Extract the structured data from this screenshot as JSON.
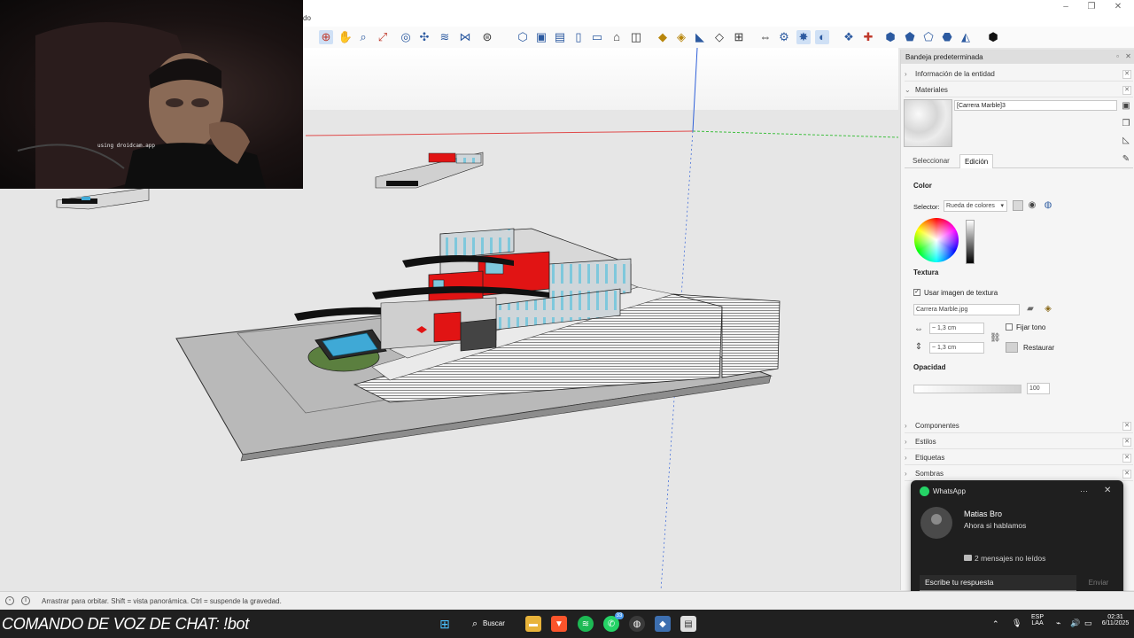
{
  "titlebar": {
    "menu_fragment": "do"
  },
  "toolbar": {
    "icons": [
      "orbit-icon",
      "pan-icon",
      "zoom-icon",
      "zoom-extents-icon",
      "component-icon",
      "solid-tools-icon",
      "layers-icon",
      "sandbox-icon",
      "warehouse-icon",
      "view-iso-icon",
      "view-top-icon",
      "view-front-icon",
      "view-right-icon",
      "view-back-icon",
      "view-left-icon",
      "section-plane-icon",
      "paint-bucket-icon",
      "tape-measure-icon",
      "protractor-icon",
      "walk-icon",
      "look-around-icon",
      "position-camera-icon",
      "extension-icon",
      "extension-warehouse-icon",
      "ruby-icon",
      "dynamic-component-icon",
      "sketchup-logo-icon"
    ]
  },
  "webcam": {
    "overlay_text": "using droidcam.app"
  },
  "panel": {
    "title": "Bandeja predeterminada",
    "entity_info": "Información de la entidad",
    "materials": "Materiales",
    "material_name": "[Carrera Marble]3",
    "tabs": [
      "Seleccionar",
      "Edición"
    ],
    "active_tab": "Edición",
    "color_label": "Color",
    "selector_label": "Selector:",
    "selector_value": "Rueda de colores",
    "texture_label": "Textura",
    "use_texture_label": "Usar imagen de textura",
    "use_texture_checked": true,
    "texture_file": "Carrera Marble.jpg",
    "width_value": "~ 1,3 cm",
    "height_value": "~ 1,3 cm",
    "colorize_label": "Fijar tono",
    "restore_label": "Restaurar",
    "opacity_label": "Opacidad",
    "opacity_value": "100",
    "collapsed_sections": [
      "Componentes",
      "Estilos",
      "Etiquetas",
      "Sombras"
    ]
  },
  "toast": {
    "app": "WhatsApp",
    "sender": "Matias Bro",
    "message": "Ahora si hablamos",
    "unread": "2 mensajes no leídos",
    "reply_placeholder": "Escribe tu respuesta",
    "send_label": "Enviar",
    "more_label": "···",
    "close_label": "✕"
  },
  "statusbar": {
    "hint": "Arrastrar para orbitar. Shift = vista panorámica. Ctrl = suspende la gravedad."
  },
  "overlay_chat_command": "COMANDO DE VOZ DE CHAT: !bot",
  "taskbar": {
    "search_label": "Buscar",
    "whatsapp_badge": "33",
    "lang_line1": "ESP",
    "lang_line2": "LAA",
    "time": "02:31",
    "date": "6/11/2025"
  },
  "colors": {
    "accent_red": "#e11414",
    "glass_blue": "#7ec8dc",
    "whatsapp_green": "#25d366",
    "taskbar_bg": "#202020",
    "panel_bg": "#f5f5f5"
  }
}
